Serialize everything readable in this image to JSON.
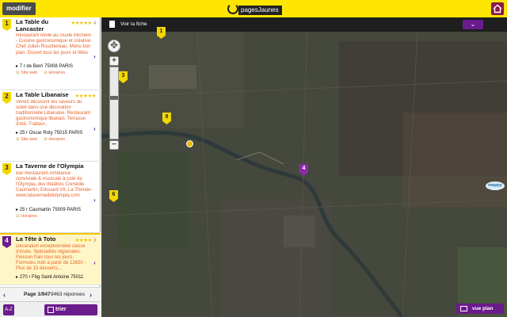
{
  "header": {
    "modifier_label": "modifier",
    "logo_text": "pagesJaunes"
  },
  "results": [
    {
      "number": "1",
      "title": "La Table du Lancaster",
      "rating": "★★★★★",
      "review_count": "4",
      "description": "Restaurant étoilé au Guide Michelin - Cuisine gastronomique et créative. Chef Julien Rouchereau. Menu bon plan. Ouvert tous les jours et fêtes",
      "address": "7 r de Berri 75008 PARIS",
      "links": [
        "Site web",
        "Horaires"
      ]
    },
    {
      "number": "2",
      "title": "La Table Libanaise",
      "rating": "★★★★★",
      "review_count": "",
      "description": "Venez découvrir les saveurs du soleil dans une décoration traditionnelle Libanaise. Restaurant gastronomique libanais. Terrasse d'été. Traiteur...",
      "address": "25 r Oscar Roty 75015 PARIS",
      "links": [
        "Site web",
        "Horaires"
      ]
    },
    {
      "number": "3",
      "title": "La Taverne de l'Olympia",
      "rating": "",
      "review_count": "",
      "description": "Bar-Restaurant-Ambiance conviviale & musicale à coté de l'Olympia, des théâtres Comédie Caumartin, Edouard VII, La Thénée- www.latavernedelolympia.com",
      "address": "25 r Caumartin 75009 PARIS",
      "links": [
        "Horaires"
      ]
    },
    {
      "number": "4",
      "title": "La Tête à Toto",
      "rating": "★★★★",
      "review_count": "3",
      "description": "Décoration exceptionnelle classe d'école. Spécialités régionales. Poisson frais tous les jours. Formules midi à partir de 12€50 - Plus de 15 desserts...",
      "address": "270 r Fbg Saint Antoine 75011",
      "links": []
    }
  ],
  "pager": {
    "page": "Page 1/947",
    "results": "9463 réponses"
  },
  "sort": {
    "az_label": "A-Z",
    "trier_label": "trier"
  },
  "map": {
    "voir_fiche_label": "Voir la fiche",
    "dropdown_icon": "⌄",
    "mappy_label": "mappy",
    "vue_plan_label": "vue plan",
    "markers": [
      "1",
      "3",
      "9",
      "4",
      "6"
    ]
  },
  "colors": {
    "brand_yellow": "#ffe600",
    "accent_purple": "#6a1b8c",
    "description_orange": "#e8622a"
  }
}
